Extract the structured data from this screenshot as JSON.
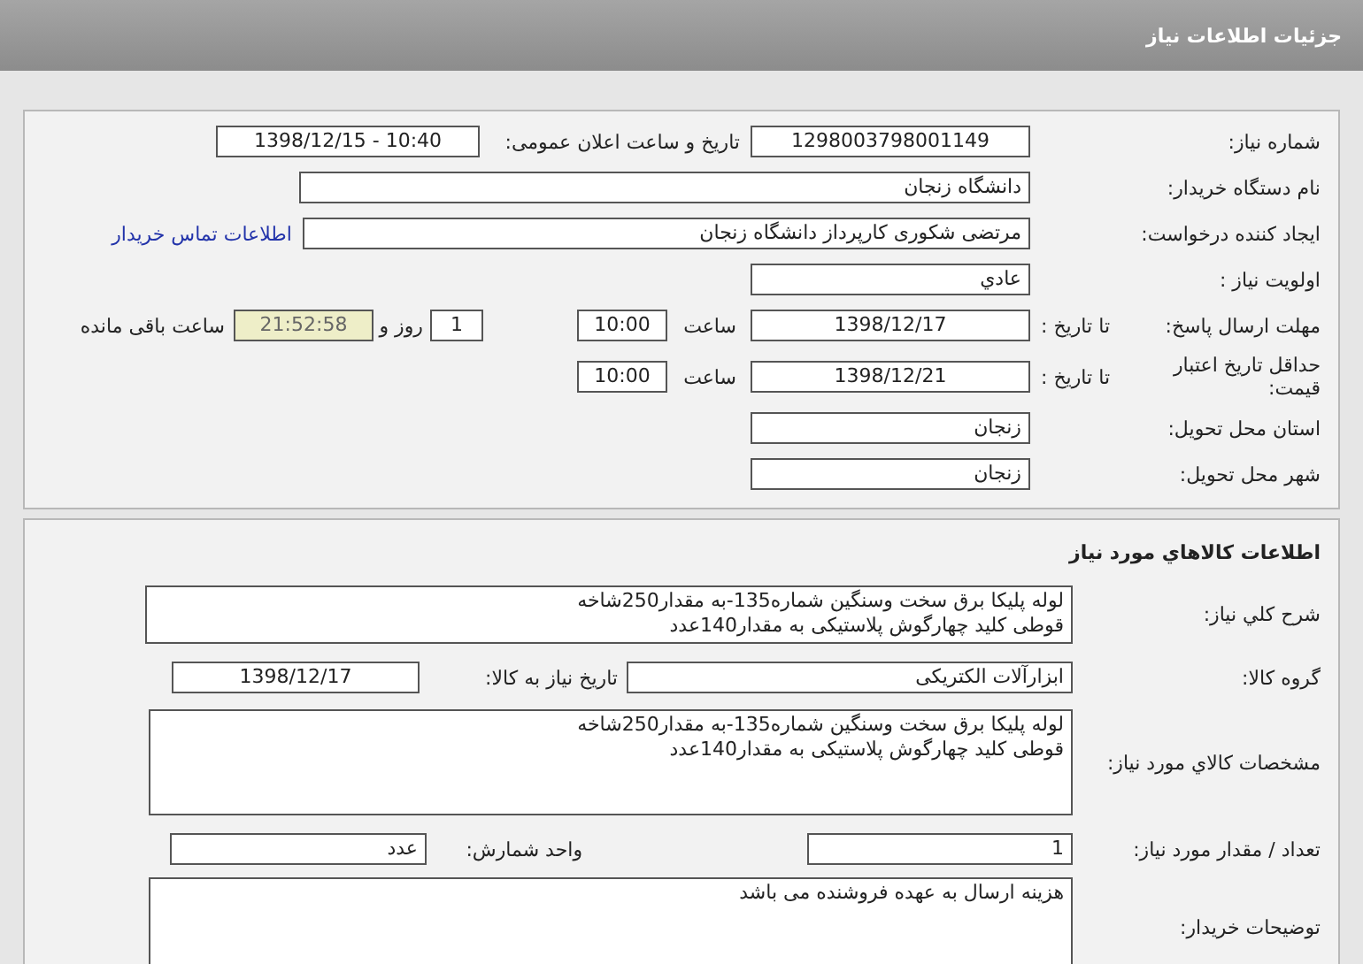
{
  "header": {
    "title": "جزئیات اطلاعات نیاز"
  },
  "need_info": {
    "need_number": {
      "label": "شماره نیاز:",
      "value": "1298003798001149"
    },
    "announce": {
      "label": "تاریخ و ساعت اعلان عمومی:",
      "value": "1398/12/15 - 10:40"
    },
    "buyer": {
      "label": "نام دستگاه خریدار:",
      "value": "دانشگاه زنجان"
    },
    "requester": {
      "label": "ایجاد کننده درخواست:",
      "value": "مرتضی شکوری کارپرداز دانشگاه زنجان",
      "link": "اطلاعات تماس خریدار"
    },
    "priority": {
      "label": "اولویت نیاز :",
      "value": "عادي"
    },
    "deadline": {
      "label": "مهلت ارسال پاسخ:",
      "to_date_label": "تا تاریخ :",
      "date": "1398/12/17",
      "time_label": "ساعت",
      "time": "10:00",
      "days": "1",
      "days_label": "روز و",
      "remaining": "21:52:58",
      "remaining_label": "ساعت باقی مانده"
    },
    "validity": {
      "label": "حداقل تاریخ اعتبار قیمت:",
      "to_date_label": "تا تاریخ :",
      "date": "1398/12/21",
      "time_label": "ساعت",
      "time": "10:00"
    },
    "province": {
      "label": "استان محل تحویل:",
      "value": "زنجان"
    },
    "city": {
      "label": "شهر محل تحویل:",
      "value": "زنجان"
    }
  },
  "goods": {
    "title": "اطلاعات کالاهاي مورد نیاز",
    "description": {
      "label": "شرح کلي نیاز:",
      "lines": [
        "لوله پلیکا برق سخت وسنگین شماره135-به مقدار250شاخه",
        "قوطی کلید چهارگوش پلاستیکی به مقدار140عدد"
      ]
    },
    "group": {
      "label": "گروه کالا:",
      "value": "ابزارآلات الکتریکی",
      "need_date_label": "تاریخ نیاز به کالا:",
      "need_date": "1398/12/17"
    },
    "specs": {
      "label": "مشخصات کالاي مورد نیاز:",
      "lines": [
        "لوله پلیکا برق سخت وسنگین شماره135-به مقدار250شاخه",
        "قوطی کلید چهارگوش پلاستیکی به مقدار140عدد"
      ]
    },
    "quantity": {
      "label": "تعداد / مقدار مورد نیاز:",
      "value": "1",
      "unit_label": "واحد شمارش:",
      "unit": "عدد"
    },
    "notes": {
      "label": "توضیحات خریدار:",
      "value": "هزینه ارسال به عهده فروشنده می باشد"
    }
  }
}
